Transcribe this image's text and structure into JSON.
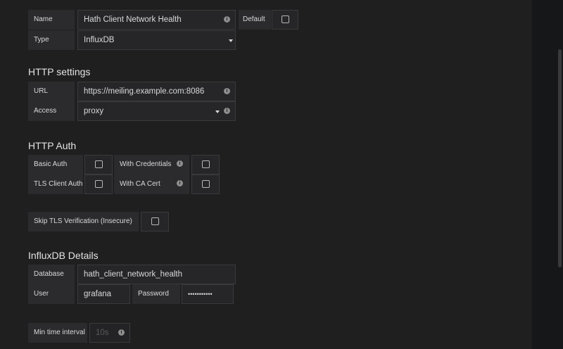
{
  "general": {
    "name_label": "Name",
    "name_value": "Hath Client Network Health",
    "default_label": "Default",
    "default_checked": false,
    "type_label": "Type",
    "type_value": "InfluxDB"
  },
  "http": {
    "heading": "HTTP settings",
    "url_label": "URL",
    "url_value": "https://meiling.example.com:8086",
    "access_label": "Access",
    "access_value": "proxy"
  },
  "auth": {
    "heading": "HTTP Auth",
    "basic_auth_label": "Basic Auth",
    "with_credentials_label": "With Credentials",
    "tls_client_auth_label": "TLS Client Auth",
    "with_ca_cert_label": "With CA Cert",
    "skip_tls_label": "Skip TLS Verification (Insecure)"
  },
  "influx": {
    "heading": "InfluxDB Details",
    "database_label": "Database",
    "database_value": "hath_client_network_health",
    "user_label": "User",
    "user_value": "grafana",
    "password_label": "Password",
    "password_value": "•••••••••••",
    "min_interval_label": "Min time interval",
    "min_interval_placeholder": "10s"
  },
  "icons": {
    "info": "info-circle-icon",
    "caret": "caret-down-icon",
    "checkbox": "checkbox-icon"
  }
}
